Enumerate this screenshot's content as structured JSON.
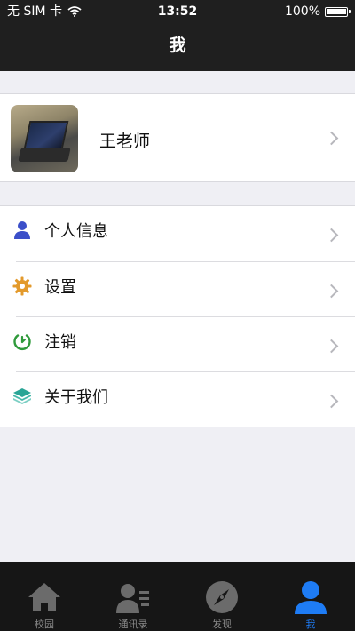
{
  "status_bar": {
    "carrier": "无 SIM 卡",
    "time": "13:52",
    "battery": "100%"
  },
  "nav": {
    "title": "我"
  },
  "profile": {
    "name": "王老师"
  },
  "menu": {
    "items": [
      {
        "label": "个人信息",
        "icon": "person-icon"
      },
      {
        "label": "设置",
        "icon": "gear-icon"
      },
      {
        "label": "注销",
        "icon": "power-icon"
      },
      {
        "label": "关于我们",
        "icon": "layers-icon"
      }
    ]
  },
  "tabbar": {
    "tabs": [
      {
        "label": "校园",
        "icon": "home-icon",
        "active": false
      },
      {
        "label": "通讯录",
        "icon": "contacts-icon",
        "active": false
      },
      {
        "label": "发现",
        "icon": "compass-icon",
        "active": false
      },
      {
        "label": "我",
        "icon": "person-icon",
        "active": true
      }
    ]
  },
  "colors": {
    "nav_bg": "#1f1f1f",
    "page_bg": "#efeff4",
    "accent": "#1e7cf5",
    "person_icon": "#3b4fc9",
    "gear_icon": "#e39a2c",
    "power_icon": "#2f9a3b",
    "layers_icon": "#2aa596"
  }
}
